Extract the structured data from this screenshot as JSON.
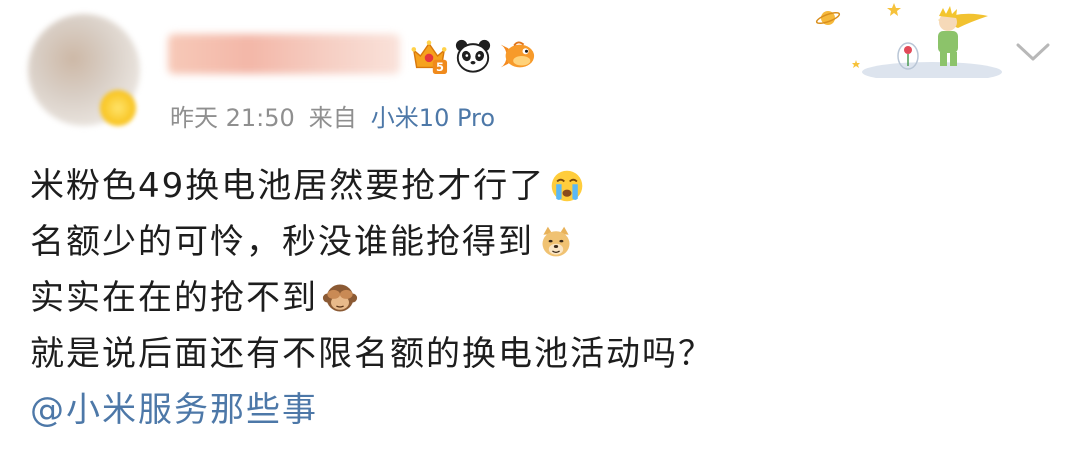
{
  "post_header": {
    "username": "████████",
    "badges": [
      "crown-level-5-icon",
      "panda-icon",
      "fish-icon"
    ],
    "badge_level": "5",
    "time": "昨天 21:50",
    "source_prefix": "来自",
    "source_device": "小米10 Pro"
  },
  "post_body": {
    "lines": [
      {
        "text": "米粉色49换电池居然要抢才行了",
        "emoji": "crying-face-icon"
      },
      {
        "text": "名额少的可怜，秒没谁能抢得到",
        "emoji": "doge-icon"
      },
      {
        "text": "实实在在的抢不到",
        "emoji": "see-no-evil-monkey-icon"
      },
      {
        "text": "就是说后面还有不限名额的换电池活动吗？"
      }
    ],
    "mention": "@小米服务那些事"
  },
  "colors": {
    "text": "#1d1d1d",
    "meta": "#8f8f8f",
    "link": "#4d78a8",
    "background": "#ffffff"
  }
}
